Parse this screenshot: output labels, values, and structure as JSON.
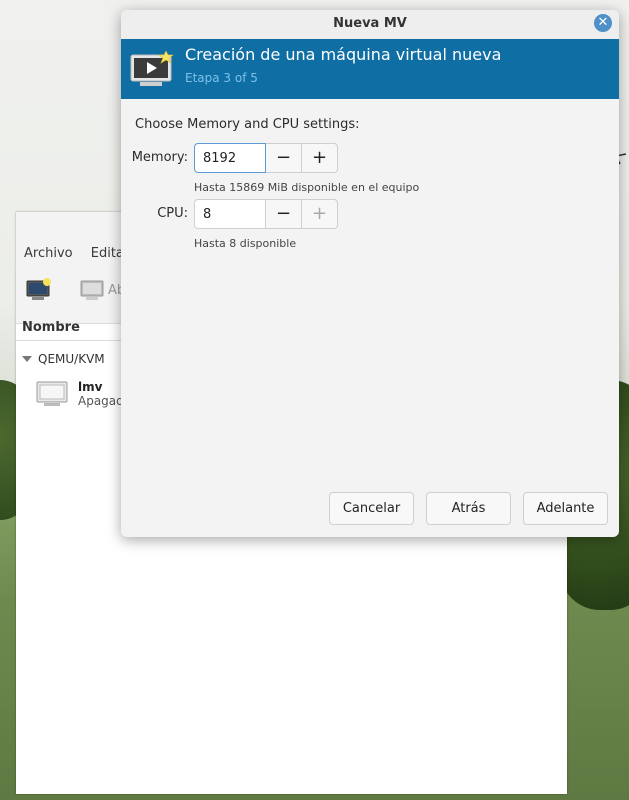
{
  "manager": {
    "menu": [
      "Archivo",
      "Editar"
    ],
    "toolbar_open_label": "Ab",
    "column_name": "Nombre",
    "group_label": "QEMU/KVM",
    "vms": [
      {
        "name": "lmv",
        "state": "Apagado"
      }
    ]
  },
  "dialog": {
    "title": "Nueva MV",
    "banner": {
      "title": "Creación de una máquina virtual nueva",
      "subtitle": "Etapa 3 of 5"
    },
    "section_label": "Choose Memory and CPU settings:",
    "memory": {
      "label": "Memory:",
      "value": "8192",
      "hint": "Hasta 15869 MiB disponible en el equipo",
      "minus": "−",
      "plus": "+"
    },
    "cpu": {
      "label": "CPU:",
      "value": "8",
      "hint": "Hasta 8 disponible",
      "minus": "−",
      "plus": "+"
    },
    "buttons": {
      "cancel": "Cancelar",
      "back": "Atrás",
      "forward": "Adelante"
    },
    "close_glyph": "✕"
  },
  "colors": {
    "banner_bg": "#0f6fa5",
    "close_bg": "#5090c8",
    "focus_border": "#5c9bd6"
  },
  "icons": [
    "monitor-new-icon",
    "monitor-icon",
    "close-icon",
    "expand-triangle-icon",
    "vm-monitor-icon"
  ]
}
